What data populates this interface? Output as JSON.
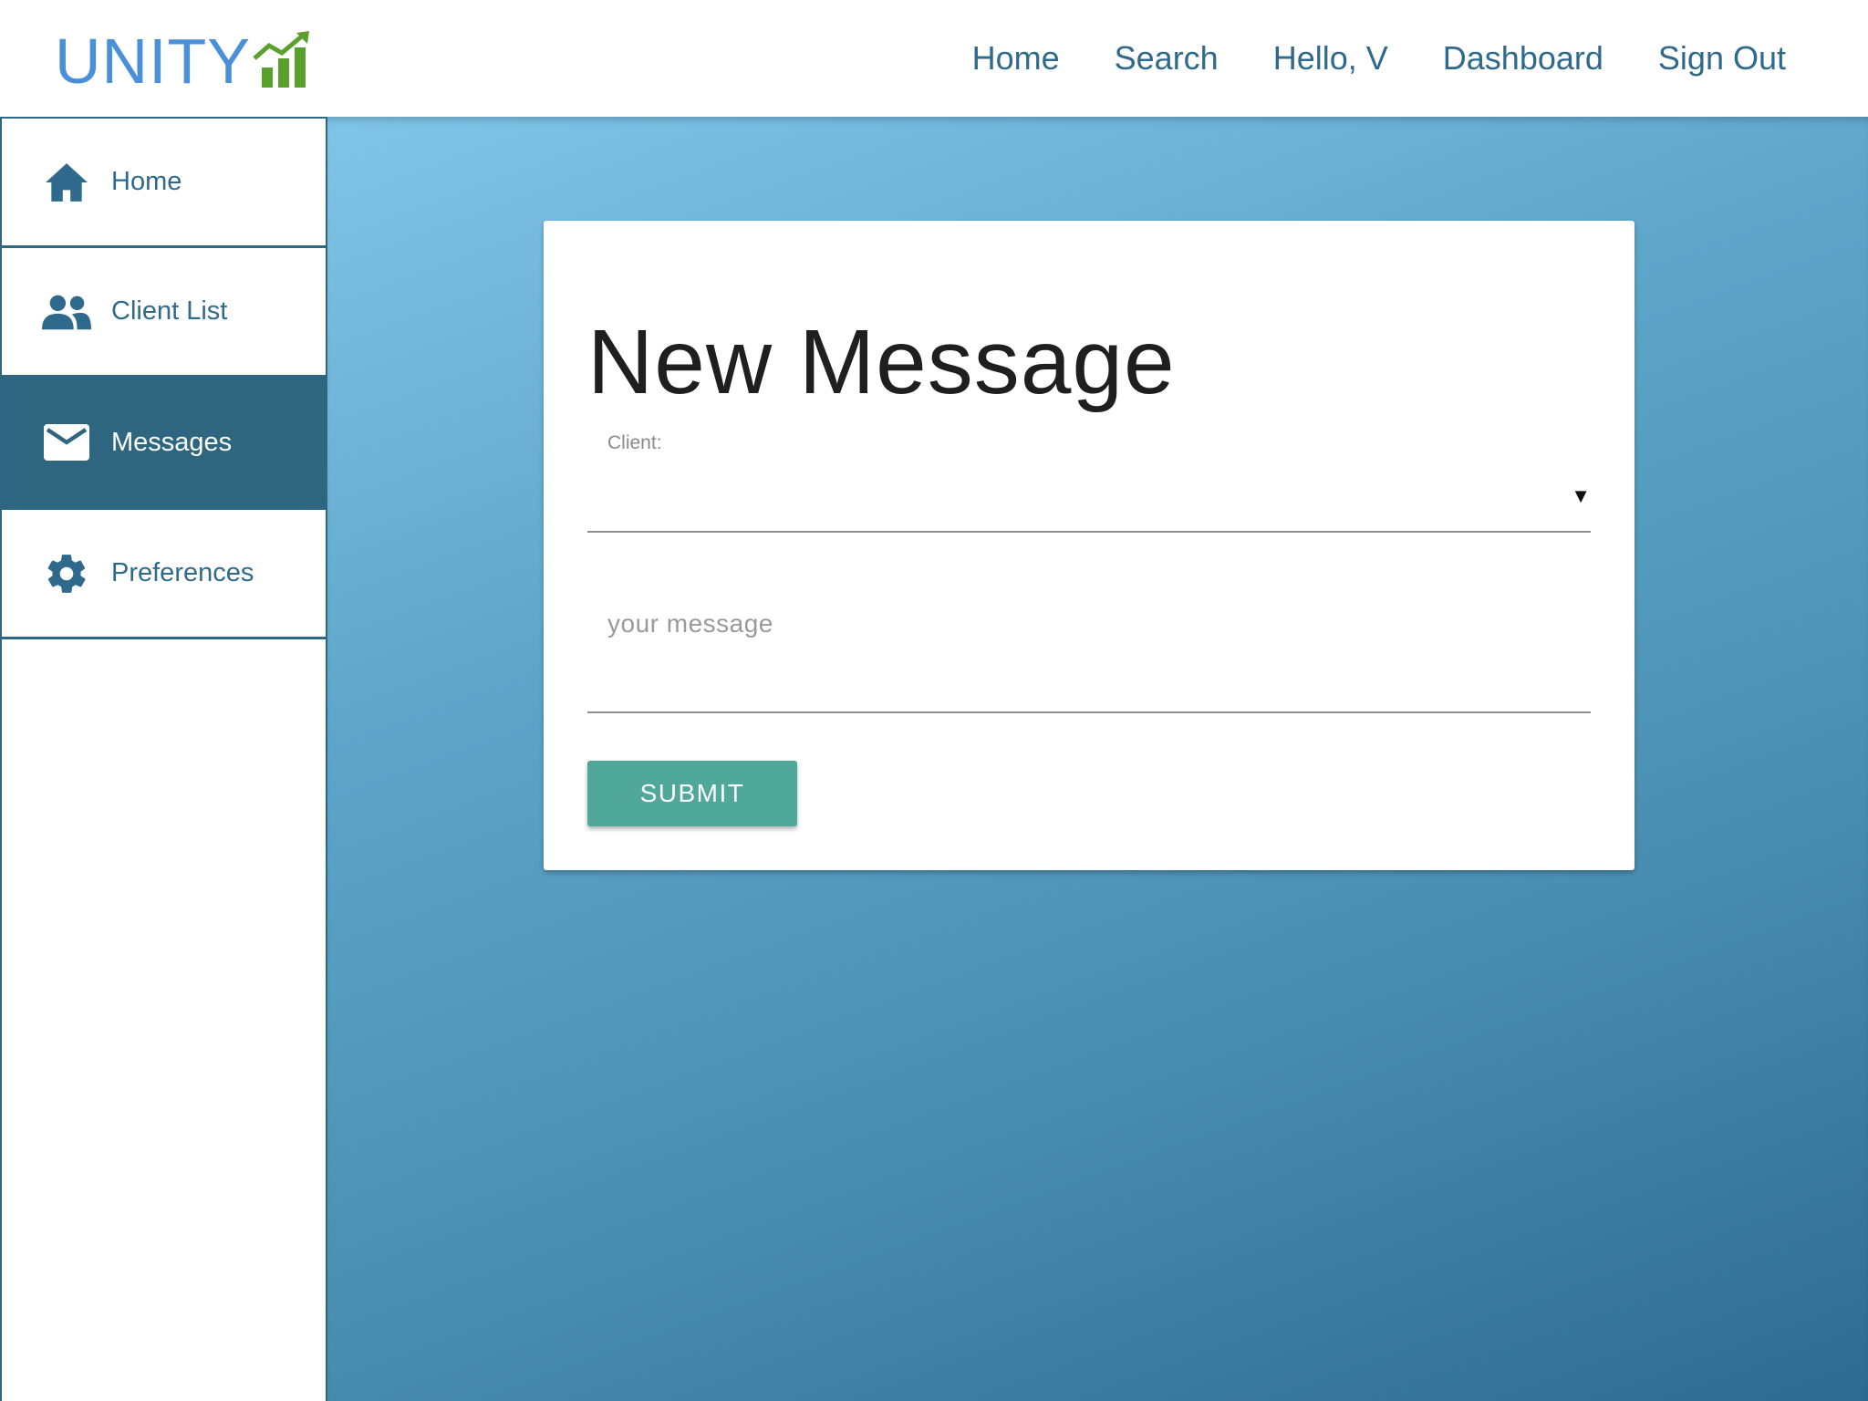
{
  "brand": {
    "name": "UNITY",
    "colors": {
      "text": "#4a90d9",
      "chart_mark": "#5aa02c"
    }
  },
  "topnav": {
    "items": [
      {
        "label": "Home"
      },
      {
        "label": "Search"
      },
      {
        "label": "Hello, V"
      },
      {
        "label": "Dashboard"
      },
      {
        "label": "Sign Out"
      }
    ]
  },
  "sidebar": {
    "items": [
      {
        "label": "Home",
        "icon": "home-icon",
        "active": false
      },
      {
        "label": "Client List",
        "icon": "people-icon",
        "active": false
      },
      {
        "label": "Messages",
        "icon": "mail-icon",
        "active": true
      },
      {
        "label": "Preferences",
        "icon": "gear-icon",
        "active": false
      }
    ]
  },
  "form": {
    "title": "New Message",
    "client_label": "Client:",
    "client_value": "",
    "dropdown_icon": "▼",
    "message_placeholder": "your message",
    "message_value": "",
    "submit_label": "SUBMIT"
  },
  "colors": {
    "nav_text": "#2f6a8c",
    "sidebar_active_bg": "#2e6680",
    "submit_bg": "#4fa899",
    "gradient_start": "#80c5e8",
    "gradient_end": "#2f6b90"
  }
}
